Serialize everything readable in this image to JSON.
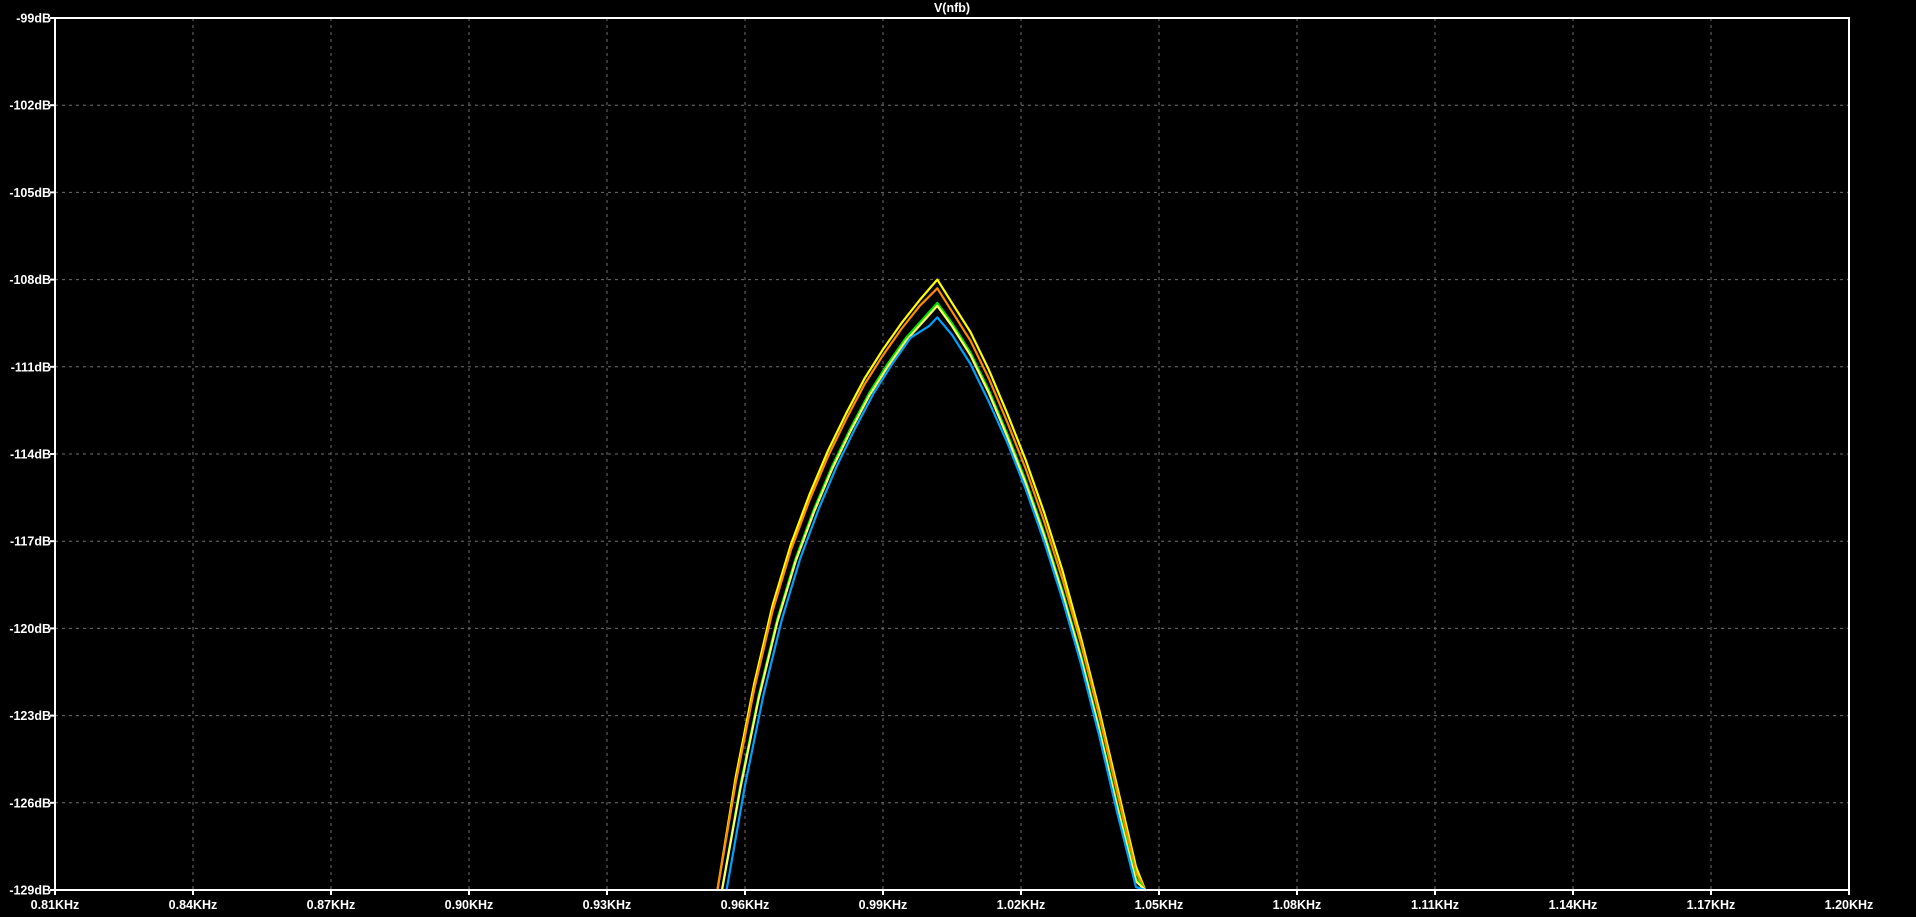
{
  "chart_data": {
    "type": "line",
    "title": "V(nfb)",
    "xlabel": "",
    "ylabel": "",
    "x_unit": "KHz",
    "y_unit": "dB",
    "xlim": [
      0.81,
      1.2
    ],
    "ylim": [
      -129,
      -99
    ],
    "x_ticks": [
      0.81,
      0.84,
      0.87,
      0.9,
      0.93,
      0.96,
      0.99,
      1.02,
      1.05,
      1.08,
      1.11,
      1.14,
      1.17,
      1.2
    ],
    "x_tick_labels": [
      "0.81KHz",
      "0.84KHz",
      "0.87KHz",
      "0.90KHz",
      "0.93KHz",
      "0.96KHz",
      "0.99KHz",
      "1.02KHz",
      "1.05KHz",
      "1.08KHz",
      "1.11KHz",
      "1.14KHz",
      "1.17KHz",
      "1.20KHz"
    ],
    "y_ticks": [
      -99,
      -102,
      -105,
      -108,
      -111,
      -114,
      -117,
      -120,
      -123,
      -126,
      -129
    ],
    "y_tick_labels": [
      "-99dB",
      "-102dB",
      "-105dB",
      "-108dB",
      "-111dB",
      "-114dB",
      "-117dB",
      "-120dB",
      "-123dB",
      "-126dB",
      "-129dB"
    ],
    "grid": true,
    "background": "#000000",
    "series": [
      {
        "color": "#ffff00",
        "x": [
          0.954,
          0.958,
          0.962,
          0.966,
          0.97,
          0.974,
          0.978,
          0.982,
          0.986,
          0.99,
          0.994,
          0.998,
          1.0018,
          1.005,
          1.009,
          1.013,
          1.017,
          1.021,
          1.025,
          1.029,
          1.033,
          1.037,
          1.041,
          1.045,
          1.047
        ],
        "y": [
          -129.0,
          -125.1,
          -121.9,
          -119.2,
          -117.1,
          -115.4,
          -113.9,
          -112.6,
          -111.4,
          -110.4,
          -109.5,
          -108.7,
          -108.0,
          -108.8,
          -109.8,
          -111.1,
          -112.6,
          -114.2,
          -116.0,
          -118.0,
          -120.3,
          -122.8,
          -125.5,
          -128.2,
          -129.0
        ]
      },
      {
        "color": "#ff8c00",
        "x": [
          0.954,
          0.958,
          0.962,
          0.966,
          0.97,
          0.974,
          0.978,
          0.982,
          0.986,
          0.99,
          0.994,
          0.998,
          1.0018,
          1.005,
          1.009,
          1.013,
          1.017,
          1.021,
          1.025,
          1.029,
          1.033,
          1.037,
          1.041,
          1.045,
          1.047
        ],
        "y": [
          -129.0,
          -125.3,
          -122.1,
          -119.4,
          -117.3,
          -115.6,
          -114.1,
          -112.8,
          -111.6,
          -110.6,
          -109.7,
          -108.9,
          -108.3,
          -109.1,
          -110.1,
          -111.4,
          -112.9,
          -114.5,
          -116.3,
          -118.3,
          -120.5,
          -123.0,
          -125.7,
          -128.4,
          -129.0
        ]
      },
      {
        "color": "#00e000",
        "x": [
          0.955,
          0.959,
          0.963,
          0.967,
          0.971,
          0.975,
          0.979,
          0.983,
          0.987,
          0.991,
          0.995,
          0.999,
          1.0018,
          1.005,
          1.009,
          1.013,
          1.017,
          1.021,
          1.025,
          1.029,
          1.033,
          1.037,
          1.041,
          1.045,
          1.047
        ],
        "y": [
          -129.0,
          -125.4,
          -122.3,
          -119.7,
          -117.6,
          -115.9,
          -114.4,
          -113.1,
          -111.9,
          -110.9,
          -110.0,
          -109.3,
          -108.8,
          -109.5,
          -110.5,
          -111.8,
          -113.3,
          -114.9,
          -116.7,
          -118.7,
          -120.9,
          -123.4,
          -126.1,
          -128.6,
          -129.0
        ]
      },
      {
        "color": "#ffff66",
        "x": [
          0.955,
          0.959,
          0.963,
          0.967,
          0.971,
          0.975,
          0.979,
          0.983,
          0.987,
          0.991,
          0.995,
          0.999,
          1.0018,
          1.005,
          1.009,
          1.013,
          1.017,
          1.021,
          1.025,
          1.029,
          1.033,
          1.037,
          1.041,
          1.045,
          1.047
        ],
        "y": [
          -129.0,
          -125.5,
          -122.4,
          -119.8,
          -117.7,
          -116.0,
          -114.5,
          -113.2,
          -112.0,
          -111.0,
          -110.1,
          -109.4,
          -108.9,
          -109.6,
          -110.6,
          -111.9,
          -113.4,
          -115.0,
          -116.8,
          -118.8,
          -121.0,
          -123.5,
          -126.2,
          -128.7,
          -129.0
        ]
      },
      {
        "color": "#00a0ff",
        "x": [
          0.956,
          0.96,
          0.964,
          0.968,
          0.972,
          0.976,
          0.98,
          0.984,
          0.988,
          0.992,
          0.996,
          1.0,
          1.0018,
          1.005,
          1.009,
          1.013,
          1.017,
          1.021,
          1.025,
          1.029,
          1.033,
          1.037,
          1.041,
          1.045,
          1.047
        ],
        "y": [
          -129.0,
          -125.4,
          -122.3,
          -119.7,
          -117.6,
          -115.9,
          -114.4,
          -113.1,
          -111.9,
          -110.9,
          -110.0,
          -109.6,
          -109.3,
          -109.9,
          -110.9,
          -112.2,
          -113.6,
          -115.2,
          -117.0,
          -119.0,
          -121.2,
          -123.7,
          -126.4,
          -128.9,
          -129.0
        ]
      }
    ]
  }
}
